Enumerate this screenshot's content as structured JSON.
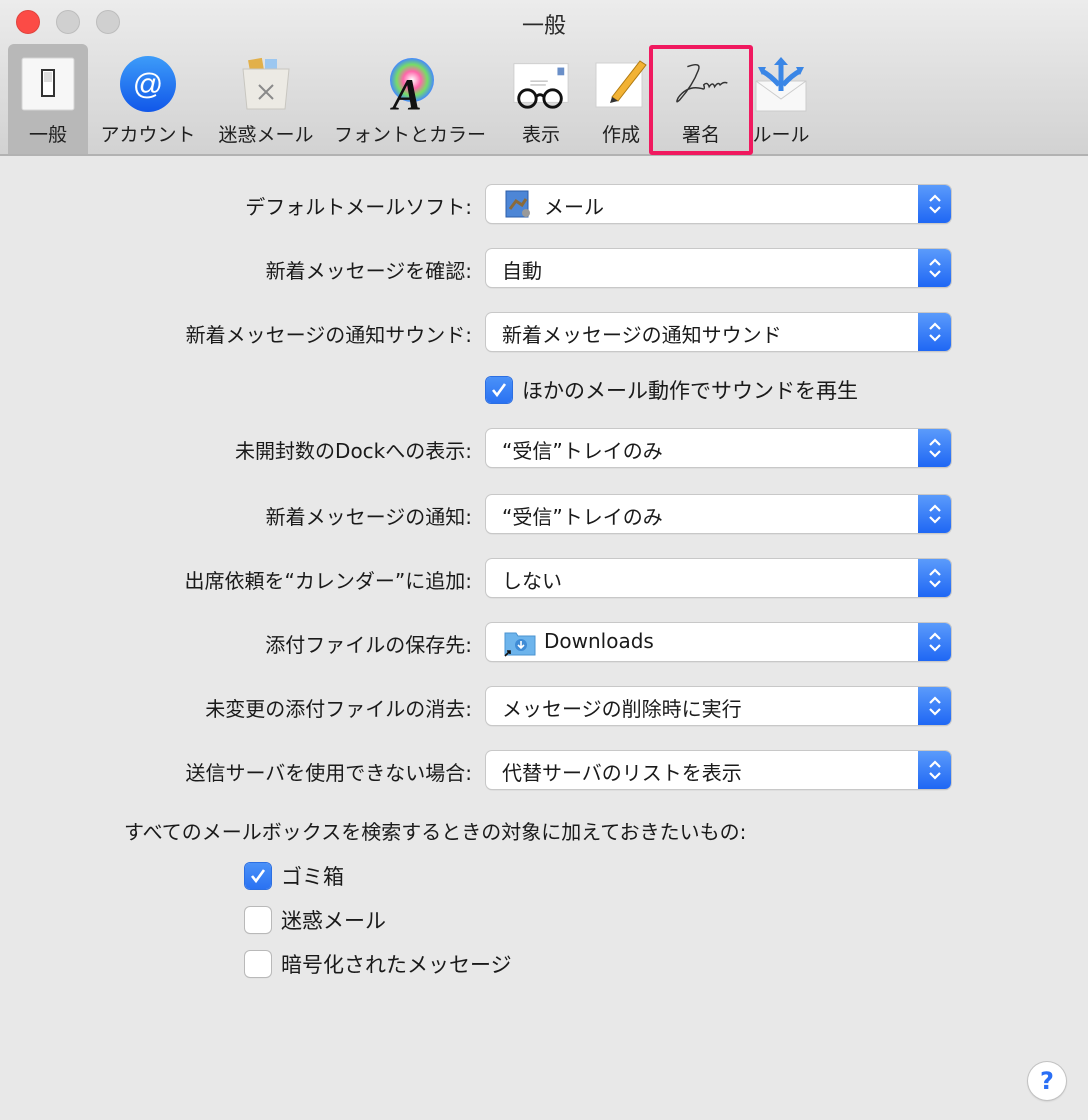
{
  "window": {
    "title": "一般"
  },
  "toolbar": {
    "items": [
      {
        "id": "general",
        "label": "一般",
        "icon": "switch-icon",
        "selected": true
      },
      {
        "id": "accounts",
        "label": "アカウント",
        "icon": "at-sign-icon",
        "selected": false
      },
      {
        "id": "junk",
        "label": "迷惑メール",
        "icon": "trash-bin-icon",
        "selected": false
      },
      {
        "id": "fonts",
        "label": "フォントとカラー",
        "icon": "font-color-icon",
        "selected": false
      },
      {
        "id": "viewing",
        "label": "表示",
        "icon": "glasses-envelope-icon",
        "selected": false
      },
      {
        "id": "composing",
        "label": "作成",
        "icon": "pencil-paper-icon",
        "selected": false
      },
      {
        "id": "signatures",
        "label": "署名",
        "icon": "signature-icon",
        "selected": false,
        "highlighted": true
      },
      {
        "id": "rules",
        "label": "ルール",
        "icon": "rules-envelope-icon",
        "selected": false
      }
    ],
    "highlight_color": "#f0195f"
  },
  "settings": {
    "default_mail": {
      "label": "デフォルトメールソフト:",
      "value": "メール",
      "icon": "mail-app-icon"
    },
    "check_new": {
      "label": "新着メッセージを確認:",
      "value": "自動"
    },
    "new_sound": {
      "label": "新着メッセージの通知サウンド:",
      "value": "新着メッセージの通知サウンド"
    },
    "play_sounds": {
      "label": "ほかのメール動作でサウンドを再生",
      "checked": true
    },
    "dock_unread": {
      "label": "未開封数のDockへの表示:",
      "value": "“受信”トレイのみ"
    },
    "new_notify": {
      "label": "新着メッセージの通知:",
      "value": "“受信”トレイのみ"
    },
    "add_invites": {
      "label": "出席依頼を“カレンダー”に追加:",
      "value": "しない"
    },
    "downloads_folder": {
      "label": "添付ファイルの保存先:",
      "value": "Downloads",
      "icon": "downloads-folder-icon"
    },
    "remove_downloads": {
      "label": "未変更の添付ファイルの消去:",
      "value": "メッセージの削除時に実行"
    },
    "server_unavailable": {
      "label": "送信サーバを使用できない場合:",
      "value": "代替サーバのリストを表示"
    }
  },
  "search_include": {
    "heading": "すべてのメールボックスを検索するときの対象に加えておきたいもの:",
    "options": [
      {
        "label": "ゴミ箱",
        "checked": true
      },
      {
        "label": "迷惑メール",
        "checked": false
      },
      {
        "label": "暗号化されたメッセージ",
        "checked": false
      }
    ]
  },
  "help": {
    "label": "?"
  },
  "colors": {
    "accent": "#2a72f2",
    "close": "#fc4b46"
  }
}
